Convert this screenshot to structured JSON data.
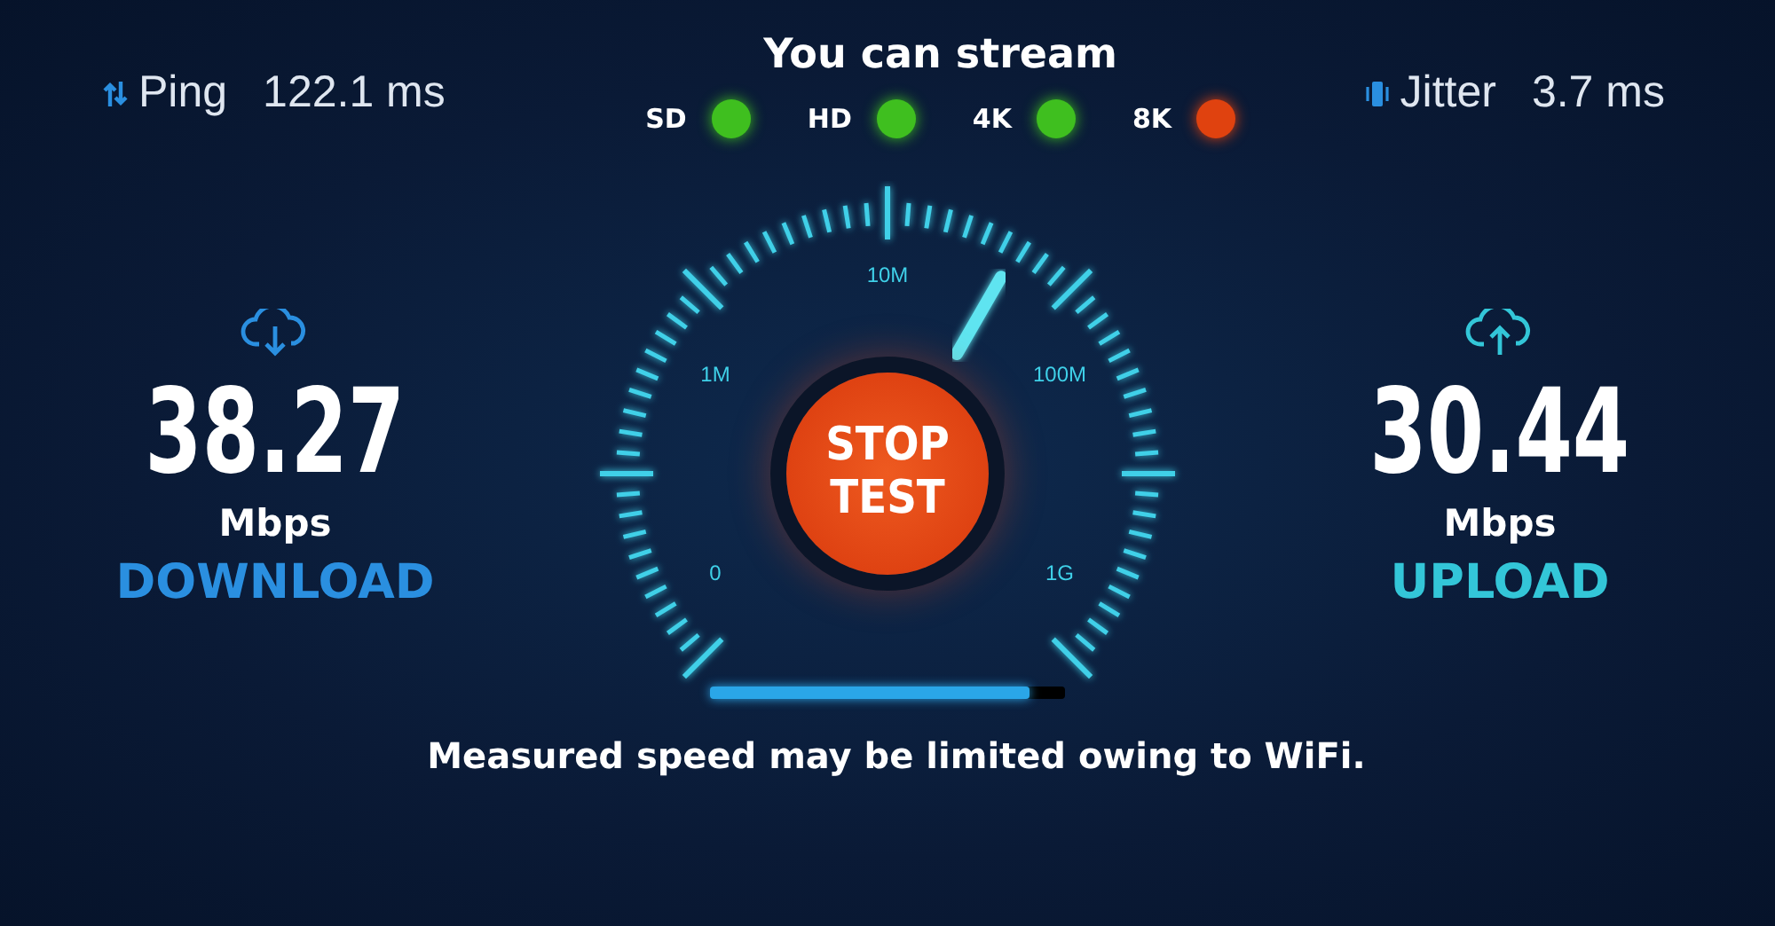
{
  "ping": {
    "label": "Ping",
    "value": "122.1 ms"
  },
  "jitter": {
    "label": "Jitter",
    "value": "3.7 ms"
  },
  "stream": {
    "title": "You can stream",
    "items": [
      {
        "label": "SD",
        "color": "#3fbf1f"
      },
      {
        "label": "HD",
        "color": "#3fbf1f"
      },
      {
        "label": "4K",
        "color": "#3fbf1f"
      },
      {
        "label": "8K",
        "color": "#e0420f"
      }
    ]
  },
  "download": {
    "value": "38.27",
    "unit": "Mbps",
    "label": "DOWNLOAD"
  },
  "upload": {
    "value": "30.44",
    "unit": "Mbps",
    "label": "UPLOAD"
  },
  "gauge": {
    "labels": [
      "0",
      "1M",
      "10M",
      "100M",
      "1G"
    ],
    "button": "STOP\nTEST"
  },
  "progress": {
    "level": 0.9
  },
  "message": "Measured speed may be limited owing to WiFi."
}
